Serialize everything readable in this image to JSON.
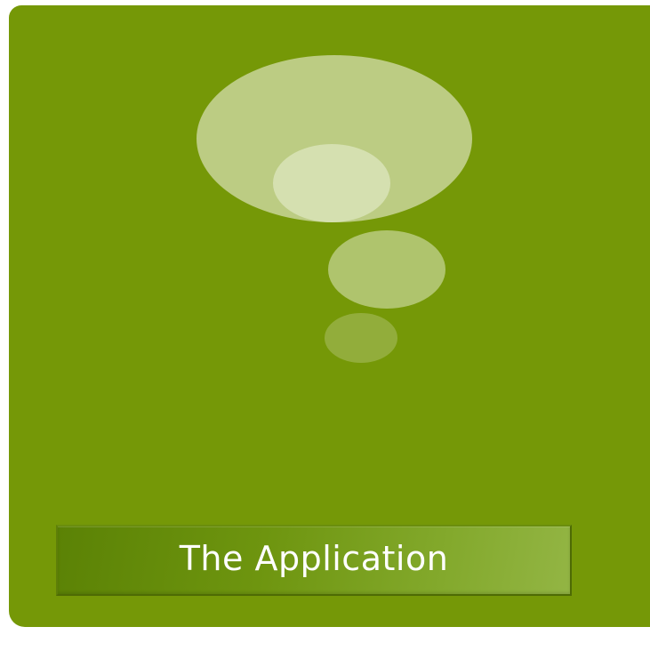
{
  "slide": {
    "background_color": "#759807",
    "title": "The Application"
  },
  "graphic": {
    "icon": "thought-bubble-icon",
    "bubble_colors": [
      "#bccc83",
      "#d5e0b0",
      "#afc46d",
      "#92ad3b"
    ]
  }
}
